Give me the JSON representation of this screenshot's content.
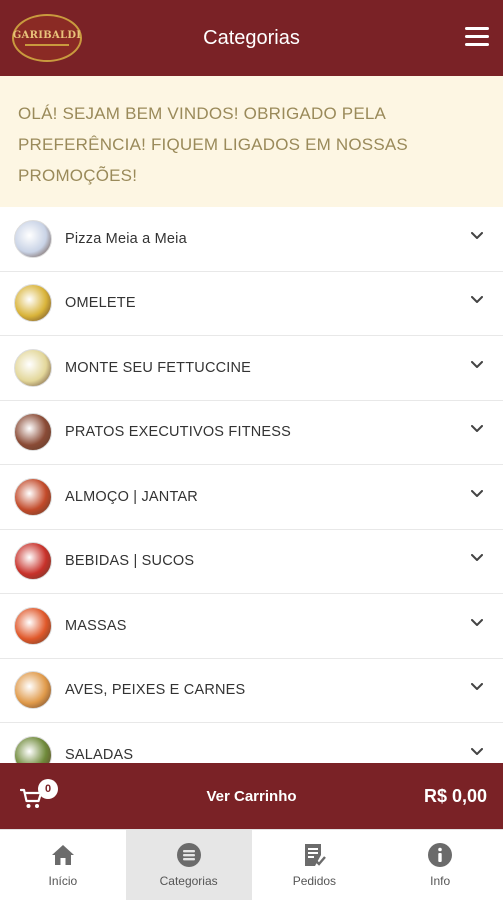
{
  "header": {
    "logo_text": "GARIBALDI",
    "title": "Categorias"
  },
  "banner": {
    "message": "OLÁ! SEJAM BEM VINDOS! OBRIGADO PELA PREFERÊNCIA! FIQUEM LIGADOS EM NOSSAS PROMOÇÕES!"
  },
  "categories": [
    {
      "label": "Pizza Meia a Meia",
      "thumb_color": "#c9d3e6"
    },
    {
      "label": "OMELETE",
      "thumb_color": "#d9b43a"
    },
    {
      "label": "MONTE SEU FETTUCCINE",
      "thumb_color": "#e3d79a"
    },
    {
      "label": "PRATOS EXECUTIVOS FITNESS",
      "thumb_color": "#8a4b36"
    },
    {
      "label": "ALMOÇO | JANTAR",
      "thumb_color": "#c24a2a"
    },
    {
      "label": "BEBIDAS | SUCOS",
      "thumb_color": "#c8312a"
    },
    {
      "label": "MASSAS",
      "thumb_color": "#e0582a"
    },
    {
      "label": "AVES, PEIXES E CARNES",
      "thumb_color": "#e09a4a"
    },
    {
      "label": "SALADAS",
      "thumb_color": "#6f8a3a"
    }
  ],
  "cart": {
    "count": "0",
    "label": "Ver Carrinho",
    "total": "R$ 0,00"
  },
  "nav": [
    {
      "label": "Início",
      "icon": "home-icon"
    },
    {
      "label": "Categorias",
      "icon": "list-icon"
    },
    {
      "label": "Pedidos",
      "icon": "receipt-icon"
    },
    {
      "label": "Info",
      "icon": "info-icon"
    }
  ],
  "colors": {
    "brand": "#7a2226",
    "banner_bg": "#fdf6e3",
    "banner_text": "#9a8a5a",
    "active_tab": "#e6e6e6"
  }
}
